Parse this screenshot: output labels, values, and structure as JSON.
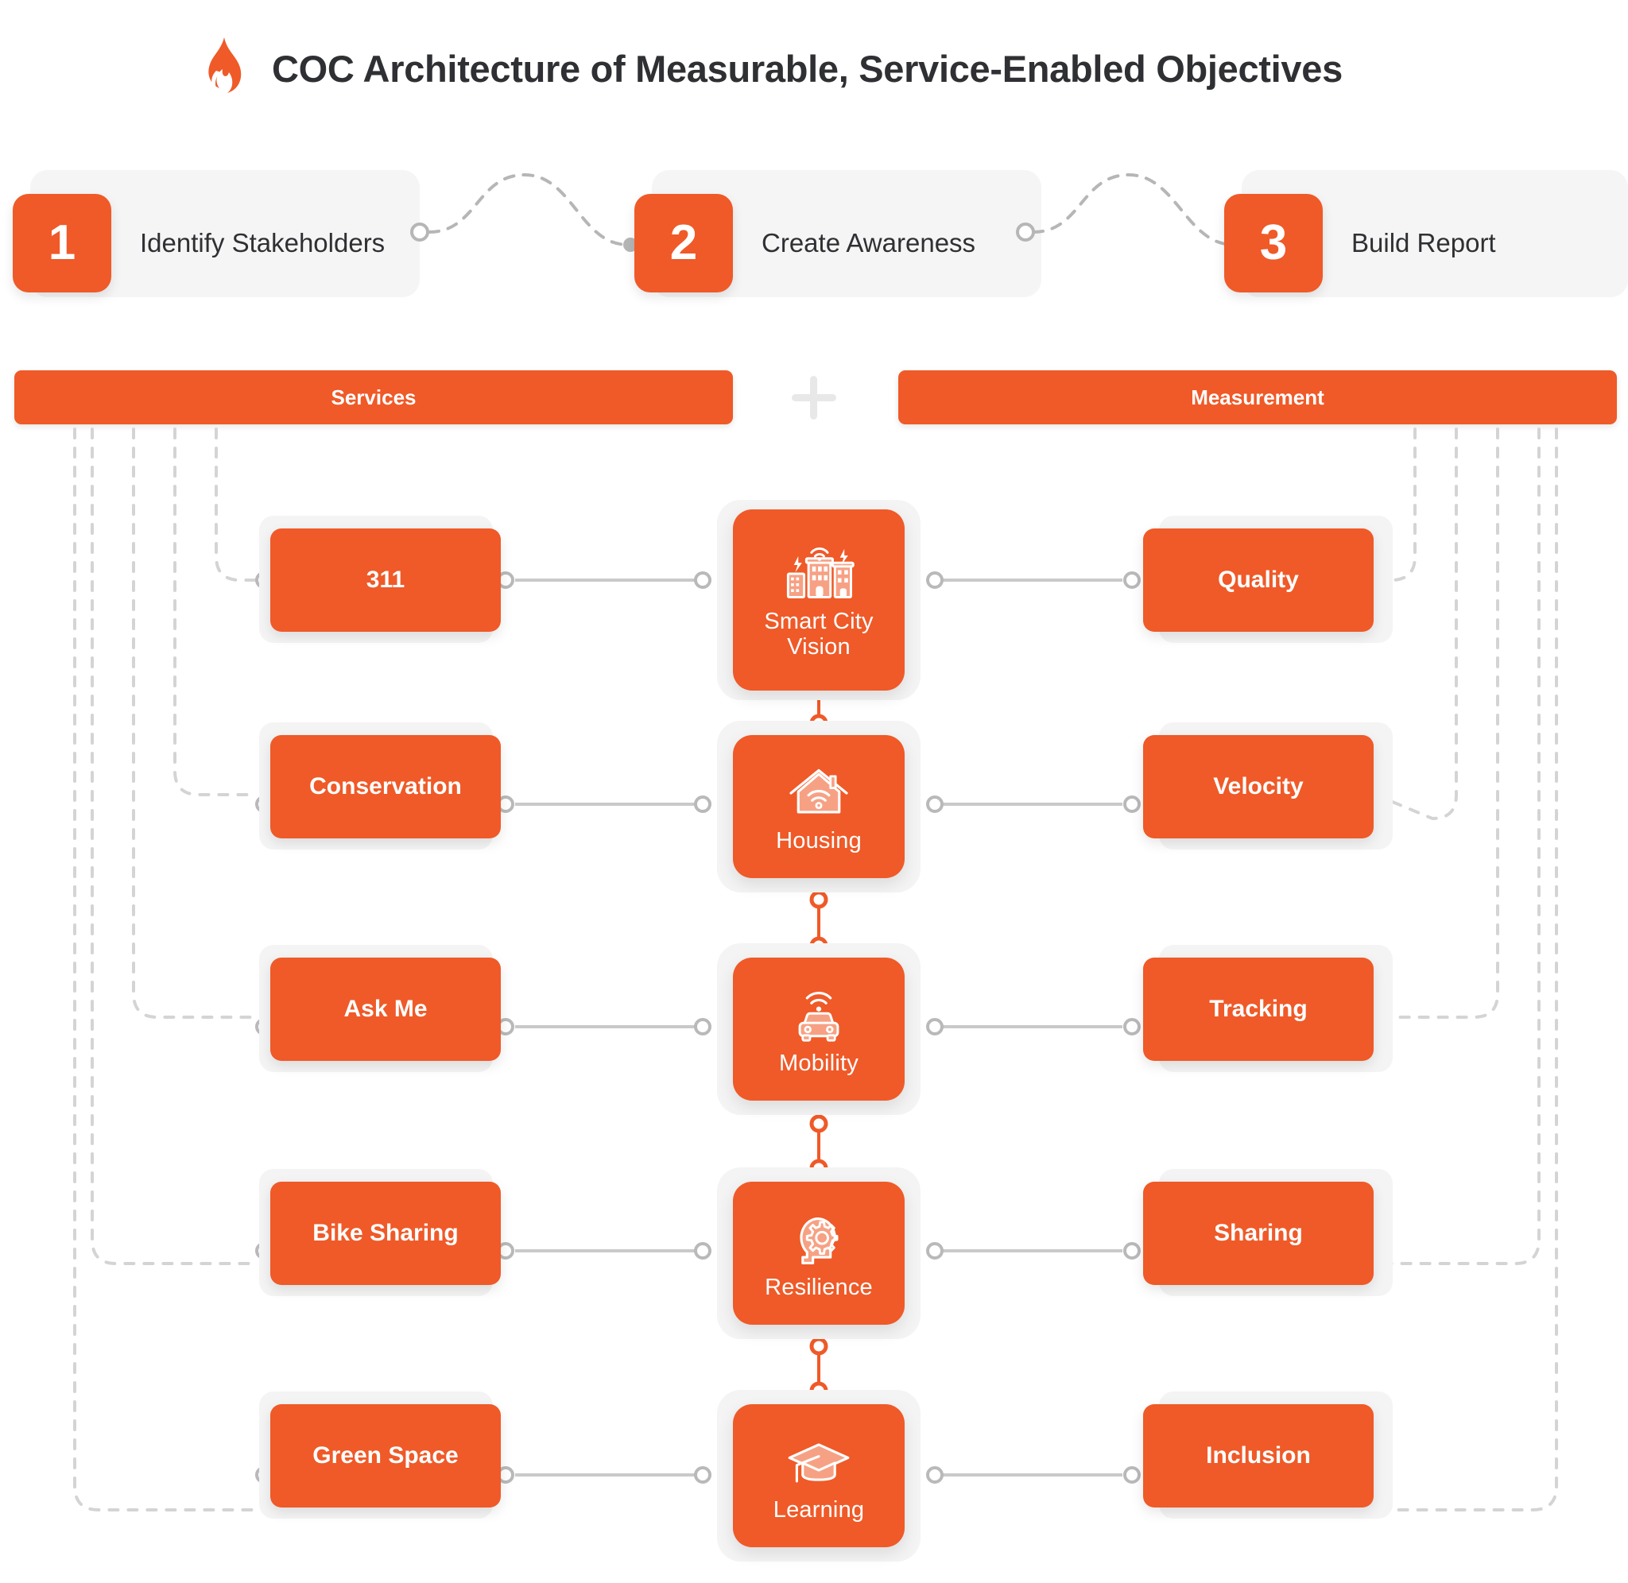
{
  "header": {
    "title": "COC Architecture of Measurable, Service-Enabled Objectives",
    "logo_icon": "flame-icon"
  },
  "colors": {
    "accent": "#ef5a28",
    "card_plate": "#f4f4f4",
    "step_card": "#f5f5f5",
    "title_text": "#2f3033",
    "wire": "#bdbdbd",
    "icon_fill": "#f7a184"
  },
  "steps": [
    {
      "number": "1",
      "label": "Identify Stakeholders"
    },
    {
      "number": "2",
      "label": "Create Awareness"
    },
    {
      "number": "3",
      "label": "Build Report"
    }
  ],
  "section_bars": {
    "left": "Services",
    "separator": "plus-icon",
    "right": "Measurement"
  },
  "rows": [
    {
      "service": "311",
      "pillar": "Smart City Vision",
      "pillar_icon": "smart-city-buildings-icon",
      "measurement": "Quality"
    },
    {
      "service": "Conservation",
      "pillar": "Housing",
      "pillar_icon": "smart-home-wifi-icon",
      "measurement": "Velocity"
    },
    {
      "service": "Ask Me",
      "pillar": "Mobility",
      "pillar_icon": "connected-car-icon",
      "measurement": "Tracking"
    },
    {
      "service": "Bike Sharing",
      "pillar": "Resilience",
      "pillar_icon": "head-gear-icon",
      "measurement": "Sharing"
    },
    {
      "service": "Green Space",
      "pillar": "Learning",
      "pillar_icon": "graduation-cap-icon",
      "measurement": "Inclusion"
    }
  ]
}
